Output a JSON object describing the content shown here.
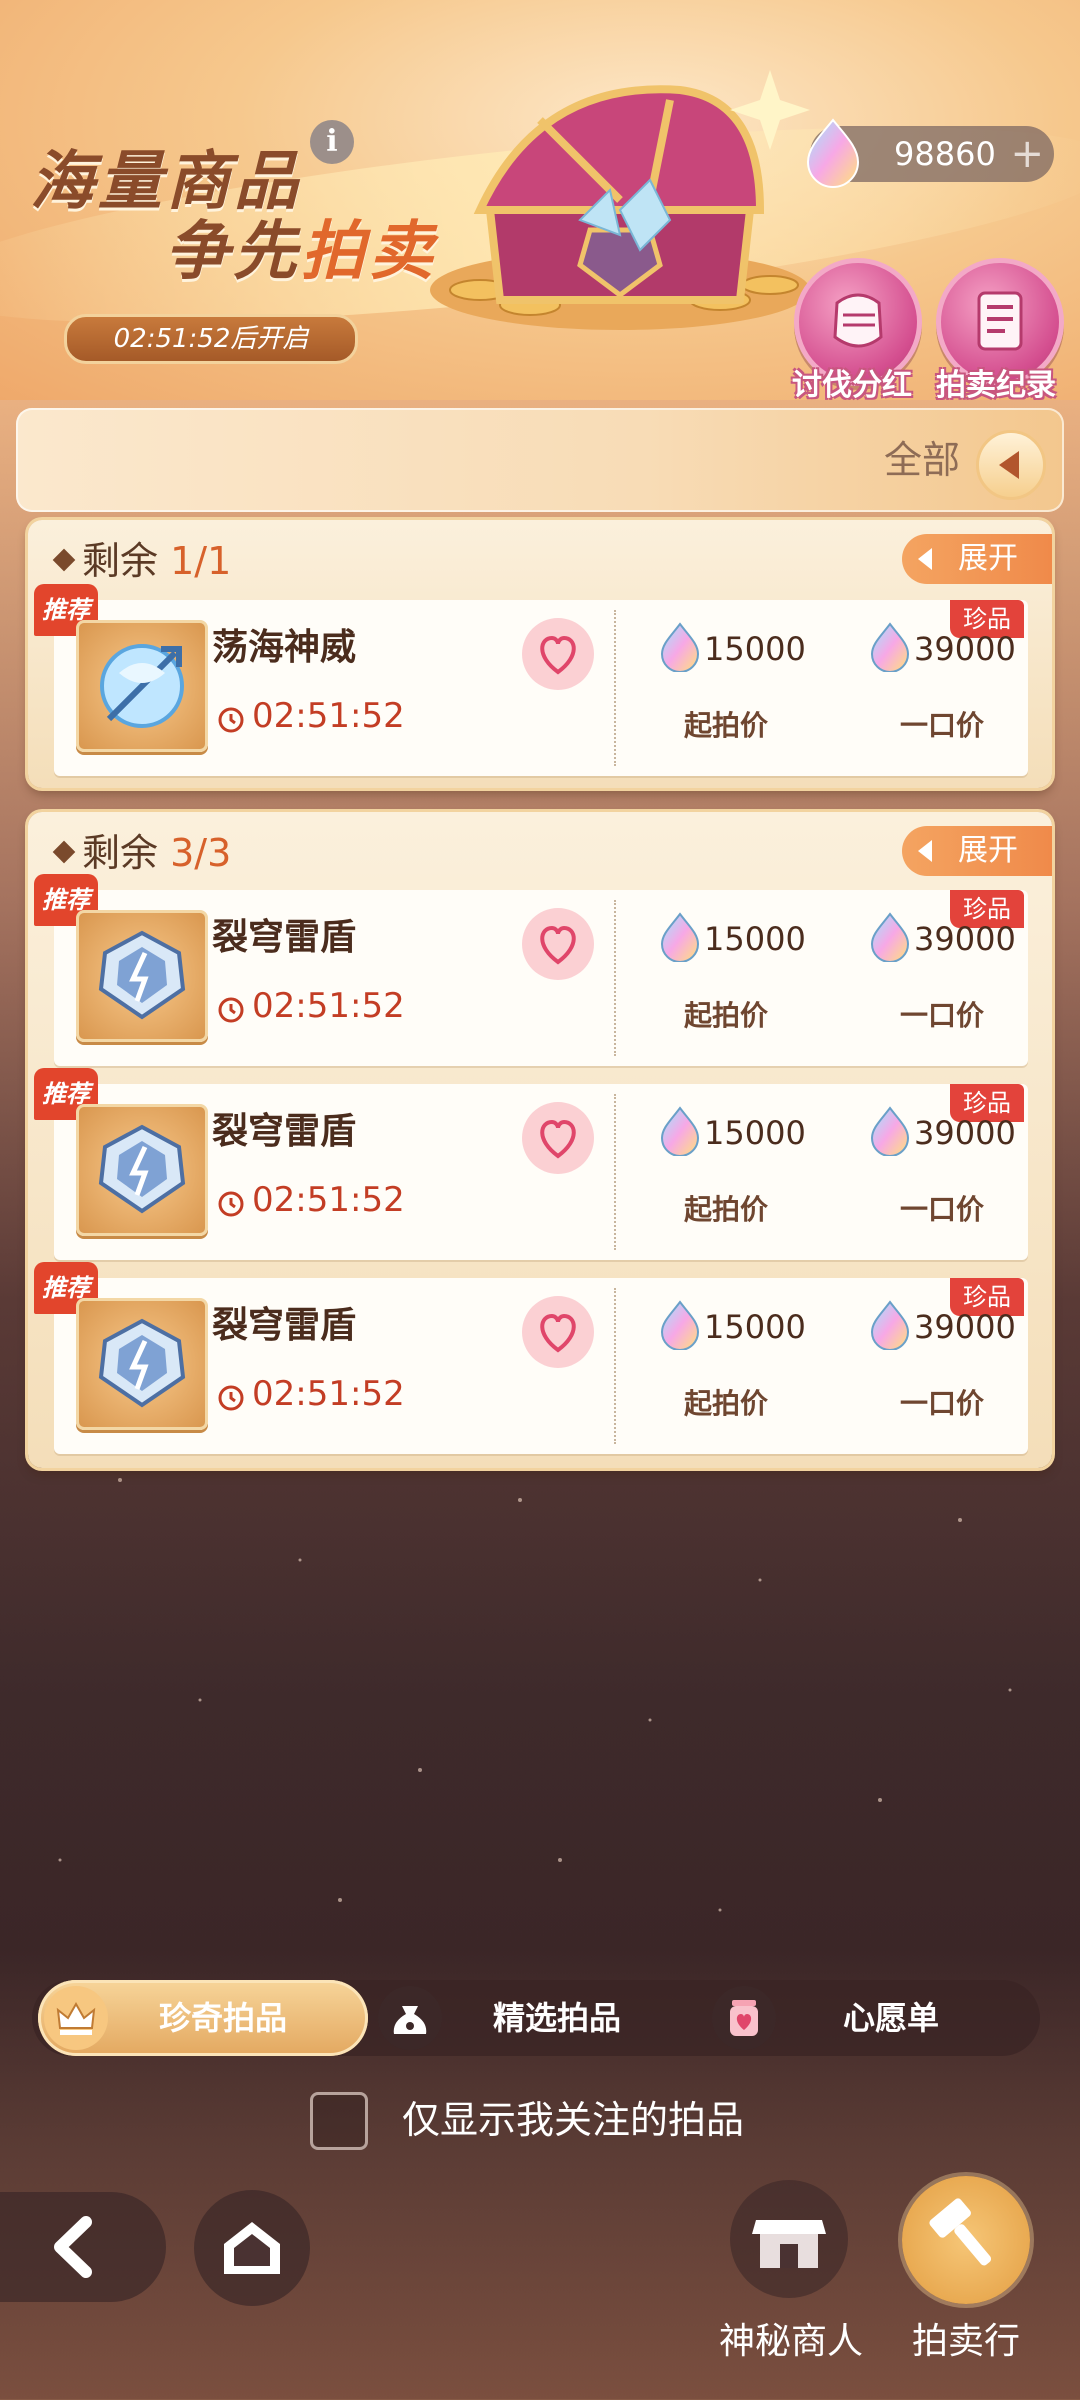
{
  "banner": {
    "title_line1": "海量商品",
    "title_line2_a": "争先",
    "title_line2_b": "拍卖",
    "countdown": "02:51:52后开启",
    "info_icon": "info-icon"
  },
  "currency": {
    "amount": "98860",
    "plus": "+"
  },
  "top_buttons": [
    {
      "label": "讨伐分红",
      "icon": "fist-icon"
    },
    {
      "label": "拍卖纪录",
      "icon": "scroll-icon"
    }
  ],
  "filter": {
    "label": "全部"
  },
  "groups": [
    {
      "remaining_label": "剩余",
      "remaining_count": "1/1",
      "expand_label": "展开",
      "items": [
        {
          "badge": "推荐",
          "name": "荡海神威",
          "countdown": "02:51:52",
          "tag": "珍品",
          "start_price": "15000",
          "start_label": "起拍价",
          "buyout_price": "39000",
          "buyout_label": "一口价"
        }
      ]
    },
    {
      "remaining_label": "剩余",
      "remaining_count": "3/3",
      "expand_label": "展开",
      "items": [
        {
          "badge": "推荐",
          "name": "裂穹雷盾",
          "countdown": "02:51:52",
          "tag": "珍品",
          "start_price": "15000",
          "start_label": "起拍价",
          "buyout_price": "39000",
          "buyout_label": "一口价"
        },
        {
          "badge": "推荐",
          "name": "裂穹雷盾",
          "countdown": "02:51:52",
          "tag": "珍品",
          "start_price": "15000",
          "start_label": "起拍价",
          "buyout_price": "39000",
          "buyout_label": "一口价"
        },
        {
          "badge": "推荐",
          "name": "裂穹雷盾",
          "countdown": "02:51:52",
          "tag": "珍品",
          "start_price": "15000",
          "start_label": "起拍价",
          "buyout_price": "39000",
          "buyout_label": "一口价"
        }
      ]
    }
  ],
  "tabs": [
    {
      "label": "珍奇拍品",
      "icon": "crown-icon",
      "active": true
    },
    {
      "label": "精选拍品",
      "icon": "money-bag-icon",
      "active": false
    },
    {
      "label": "心愿单",
      "icon": "wish-jar-icon",
      "active": false
    }
  ],
  "filter_checkbox": {
    "label": "仅显示我关注的拍品",
    "checked": false
  },
  "bottom_nav": {
    "shop_label": "神秘商人",
    "auction_label": "拍卖行"
  },
  "colors": {
    "accent": "#e3a860",
    "price_red": "#c33d24",
    "tag_red": "#e3433b"
  }
}
